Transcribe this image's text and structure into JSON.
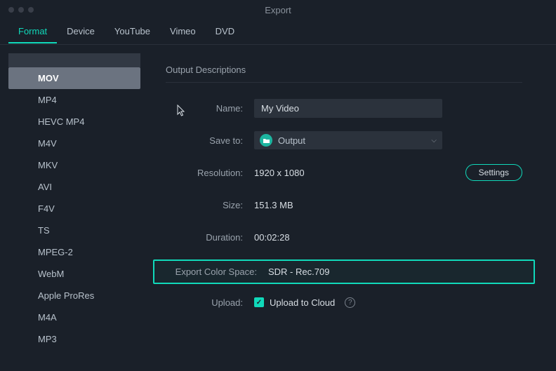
{
  "window": {
    "title": "Export"
  },
  "tabs": [
    {
      "label": "Format",
      "active": true
    },
    {
      "label": "Device"
    },
    {
      "label": "YouTube"
    },
    {
      "label": "Vimeo"
    },
    {
      "label": "DVD"
    }
  ],
  "formats": [
    {
      "label": "MOV",
      "selected": true
    },
    {
      "label": "MP4"
    },
    {
      "label": "HEVC MP4"
    },
    {
      "label": "M4V"
    },
    {
      "label": "MKV"
    },
    {
      "label": "AVI"
    },
    {
      "label": "F4V"
    },
    {
      "label": "TS"
    },
    {
      "label": "MPEG-2"
    },
    {
      "label": "WebM"
    },
    {
      "label": "Apple ProRes"
    },
    {
      "label": "M4A"
    },
    {
      "label": "MP3"
    }
  ],
  "section": {
    "title": "Output Descriptions"
  },
  "fields": {
    "name": {
      "label": "Name:",
      "value": "My Video"
    },
    "saveTo": {
      "label": "Save to:",
      "value": "Output"
    },
    "resolution": {
      "label": "Resolution:",
      "value": "1920 x 1080",
      "settings": "Settings"
    },
    "size": {
      "label": "Size:",
      "value": "151.3 MB"
    },
    "duration": {
      "label": "Duration:",
      "value": "00:02:28"
    },
    "colorSpace": {
      "label": "Export Color Space:",
      "value": "SDR - Rec.709"
    },
    "upload": {
      "label": "Upload:",
      "checkboxLabel": "Upload to Cloud",
      "checked": true
    }
  }
}
